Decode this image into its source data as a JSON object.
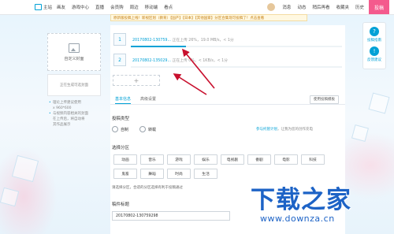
{
  "topbar": {
    "home_label": "主站",
    "nav": [
      "画友",
      "游戏中心",
      "直播",
      "会员购",
      "周边",
      "移动端",
      "看点"
    ],
    "right": [
      "消息",
      "动态",
      "稍后再看",
      "收藏夹",
      "历史"
    ],
    "upload_label": "投稿"
  },
  "notice": "原新版投稿上线！新视区划（教育）【国产】【日本】【其他国家】分区合集现可投稿了！点击查看",
  "cover": {
    "card_label": "自定义封面",
    "loading_label": "正在生成可选封面",
    "tips": [
      "理论上传建议使用",
      "x 960*600",
      "与视频内容相关的封面",
      "在上传后，将自动将",
      "其作品展示"
    ]
  },
  "files": [
    {
      "num": "1",
      "name": "20170802-130759...",
      "meta": "正在上传 26%，19.0 MB/s，< 1分",
      "progress": 0.26
    },
    {
      "num": "2",
      "name": "20170802-135029...",
      "meta": "正在上传 0%，< 1KB/s，< 1分",
      "progress": 0.0
    }
  ],
  "add_label": "+",
  "tabs": [
    "基本信息",
    "高级设置"
  ],
  "template_button": "使用投稿模板",
  "type_section": {
    "title": "投稿类型",
    "options": [
      "自制",
      "转载"
    ],
    "hint_link": "参与托管计划",
    "hint_text": "，让我为您的创作充电"
  },
  "zone_section": {
    "title": "选择分区",
    "zones": [
      "动画",
      "音乐",
      "游戏",
      "娱乐",
      "电视剧",
      "番剧",
      "电影",
      "科技",
      "鬼畜",
      "舞蹈",
      "时尚",
      "生活"
    ],
    "hint": "请选择分区，合适的分区选择有利于投稿通过"
  },
  "title_section": {
    "label": "稿件标题",
    "value": "20170802-130759298"
  },
  "right_float": [
    {
      "label": "投稿指南",
      "icon": "?"
    },
    {
      "label": "反馈建议",
      "icon": "!"
    }
  ],
  "watermark": {
    "logo": "下载之家",
    "url": "www.downza.cn"
  },
  "colors": {
    "accent": "#00a1d6",
    "upload_button": "#f45a8d",
    "arrow": "#c8102e",
    "watermark": "#1d63c6"
  }
}
